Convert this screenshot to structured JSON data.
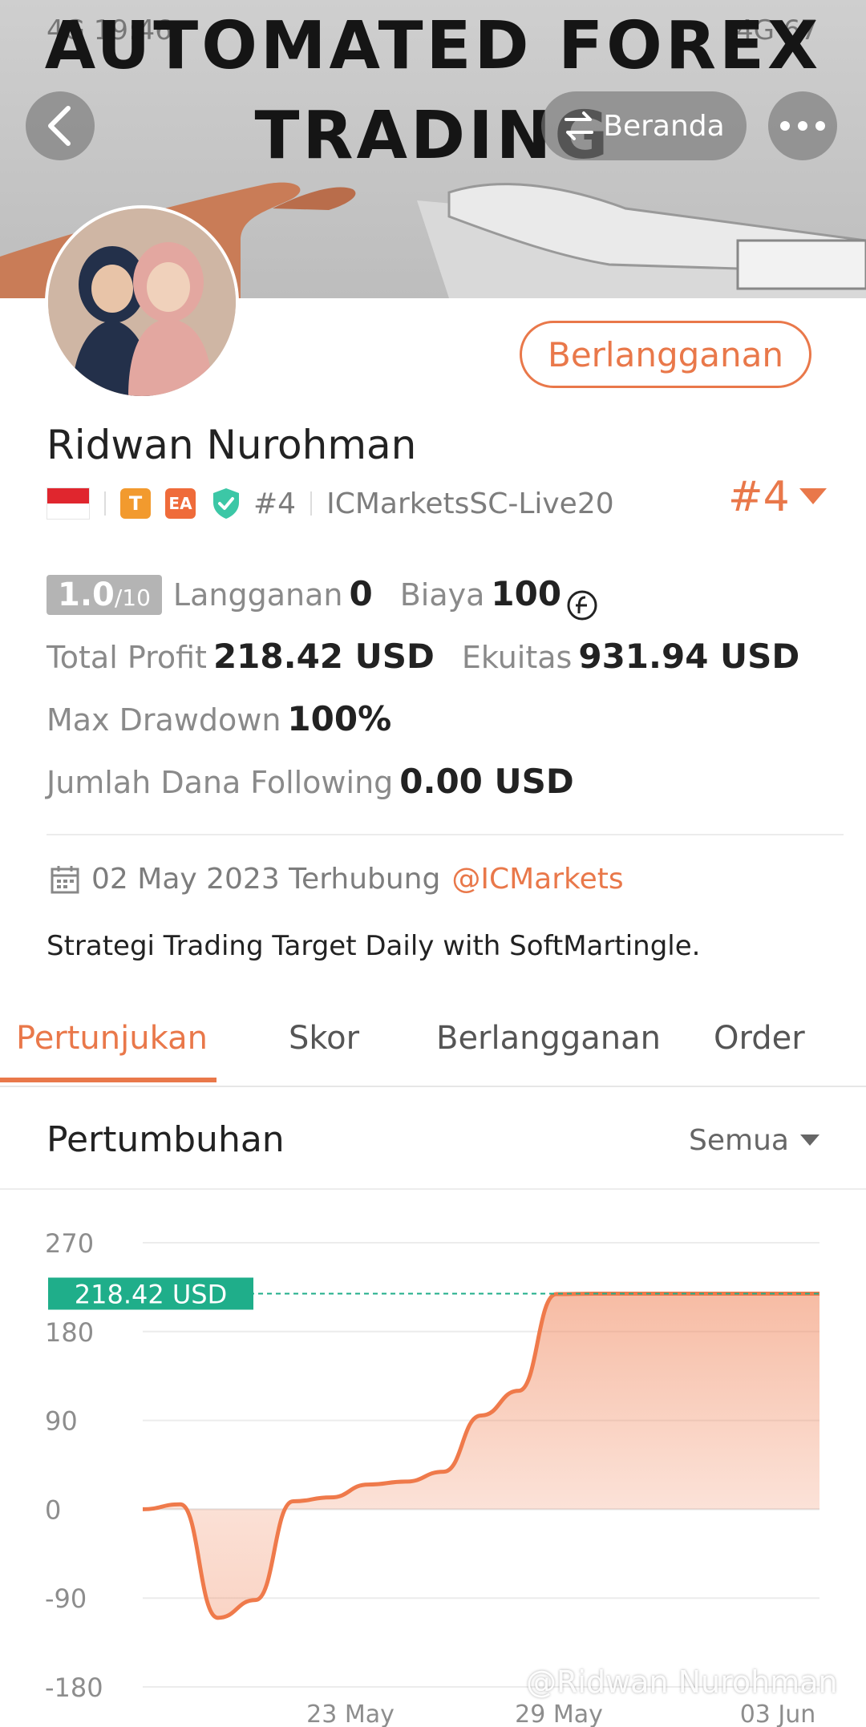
{
  "banner": {
    "title_line1": "AUTOMATED FOREX",
    "title_line2": "TRADING",
    "status_left": "4G 19:46",
    "status_right": "4G 67",
    "home_label": "Beranda"
  },
  "profile": {
    "subscribe_label": "Berlangganan",
    "name": "Ridwan Nurohman",
    "rank_tag": "#4",
    "server": "ICMarketsSC-Live20",
    "rank_big": "#4",
    "badge_t": "T",
    "badge_ea": "EA"
  },
  "stats": {
    "score": "1.0",
    "score_max": "/10",
    "subscribers_label": "Langganan",
    "subscribers_value": "0",
    "fee_label": "Biaya",
    "fee_value": "100",
    "total_profit_label": "Total Profit",
    "total_profit_value": "218.42 USD",
    "equity_label": "Ekuitas",
    "equity_value": "931.94 USD",
    "max_drawdown_label": "Max Drawdown",
    "max_drawdown_value": "100%",
    "following_label": "Jumlah Dana Following",
    "following_value": "0.00 USD"
  },
  "connection": {
    "date": "02 May 2023 Terhubung",
    "broker": "@ICMarkets"
  },
  "description": "Strategi Trading Target Daily with SoftMartingle.",
  "tabs": [
    "Pertunjukan",
    "Skor",
    "Berlangganan",
    "Order"
  ],
  "section": {
    "title": "Pertumbuhan",
    "filter": "Semua"
  },
  "watermark": "@Ridwan Nurohman",
  "colors": {
    "accent": "#e9784a",
    "badge_t": "#f29a2e",
    "badge_ea": "#ef6b3a",
    "verify": "#3cc7a6",
    "current_label": "#1fae8a"
  },
  "chart_data": {
    "type": "area",
    "ylim": [
      -180,
      270
    ],
    "yticks": [
      "270",
      "180",
      "90",
      "0",
      "-90",
      "-180"
    ],
    "x_ticks": [
      "23 May",
      "29 May",
      "03 Jun"
    ],
    "current_label": "218.42 USD",
    "current_value": 218.42,
    "series": [
      {
        "x": [
          "16 May",
          "17 May",
          "18 May",
          "19 May",
          "20 May",
          "21 May",
          "22 May",
          "23 May",
          "24 May",
          "25 May",
          "26 May",
          "27 May",
          "28 May",
          "29 May",
          "30 May",
          "31 May",
          "01 Jun",
          "02 Jun",
          "03 Jun"
        ],
        "values": [
          0,
          5,
          -110,
          -92,
          8,
          12,
          25,
          28,
          38,
          95,
          120,
          218,
          218.42,
          218.42,
          218.42,
          218.42,
          218.42,
          218.42,
          218.42
        ]
      }
    ]
  }
}
